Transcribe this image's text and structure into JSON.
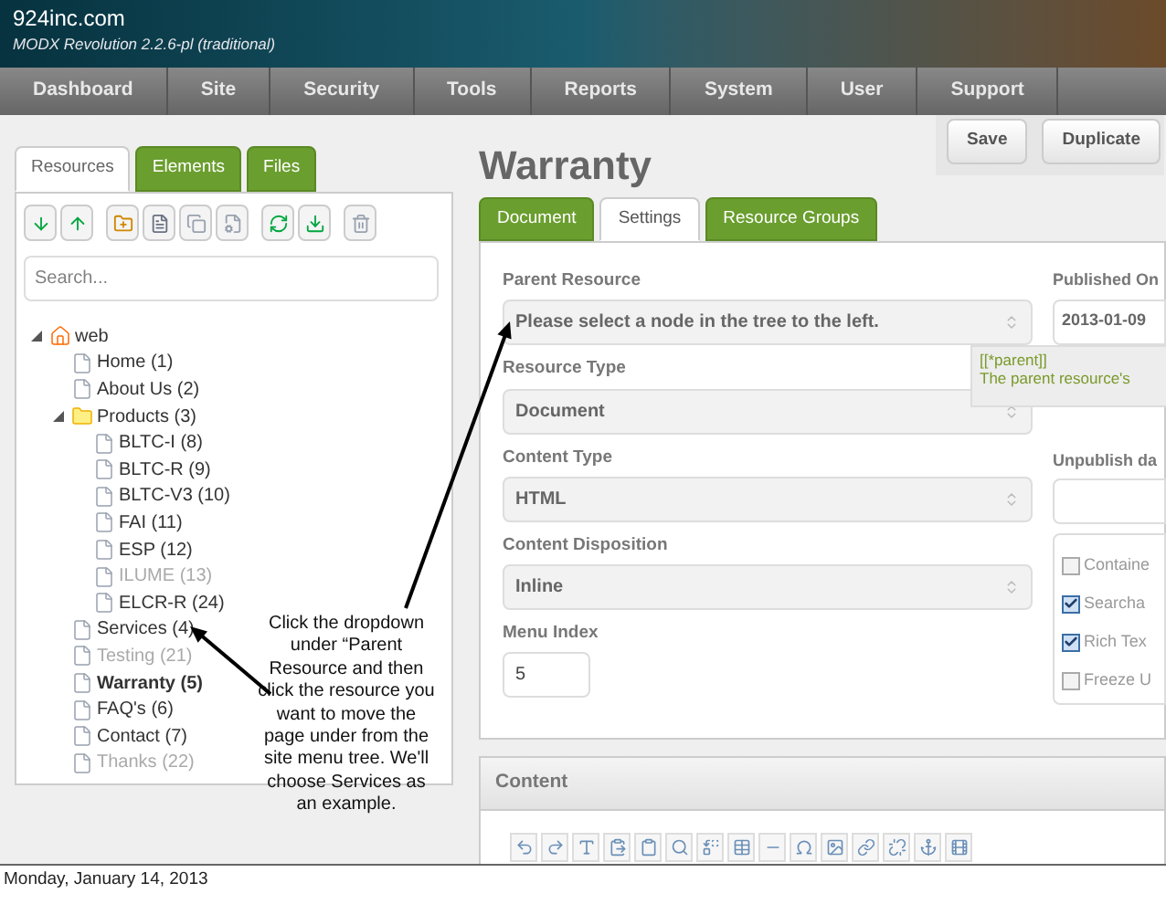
{
  "header": {
    "site": "924inc.com",
    "version": "MODX Revolution 2.2.6-pl (traditional)"
  },
  "nav": [
    "Dashboard",
    "Site",
    "Security",
    "Tools",
    "Reports",
    "System",
    "User",
    "Support"
  ],
  "left_tabs": [
    {
      "label": "Resources",
      "selected": true
    },
    {
      "label": "Elements",
      "selected": false
    },
    {
      "label": "Files",
      "selected": false
    }
  ],
  "search": {
    "placeholder": "Search..."
  },
  "tree": [
    {
      "label": "web",
      "kind": "root",
      "expanded": true,
      "published": true,
      "selected": false,
      "children": [
        {
          "label": "Home (1)",
          "kind": "page",
          "published": true,
          "selected": false
        },
        {
          "label": "About Us (2)",
          "kind": "page",
          "published": true,
          "selected": false
        },
        {
          "label": "Products (3)",
          "kind": "folder",
          "expanded": true,
          "published": true,
          "selected": false,
          "children": [
            {
              "label": "BLTC-I (8)",
              "kind": "page",
              "published": true,
              "selected": false
            },
            {
              "label": "BLTC-R (9)",
              "kind": "page",
              "published": true,
              "selected": false
            },
            {
              "label": "BLTC-V3 (10)",
              "kind": "page",
              "published": true,
              "selected": false
            },
            {
              "label": "FAI (11)",
              "kind": "page",
              "published": true,
              "selected": false
            },
            {
              "label": "ESP (12)",
              "kind": "page",
              "published": true,
              "selected": false
            },
            {
              "label": "ILUME (13)",
              "kind": "page",
              "published": false,
              "selected": false
            },
            {
              "label": "ELCR-R (24)",
              "kind": "page",
              "published": true,
              "selected": false
            }
          ]
        },
        {
          "label": "Services (4)",
          "kind": "page",
          "published": true,
          "selected": false
        },
        {
          "label": "Testing (21)",
          "kind": "page",
          "published": false,
          "selected": false
        },
        {
          "label": "Warranty (5)",
          "kind": "page",
          "published": true,
          "selected": true
        },
        {
          "label": "FAQ's (6)",
          "kind": "page",
          "published": true,
          "selected": false
        },
        {
          "label": "Contact (7)",
          "kind": "page",
          "published": true,
          "selected": false
        },
        {
          "label": "Thanks (22)",
          "kind": "page",
          "published": false,
          "selected": false
        }
      ]
    }
  ],
  "title": "Warranty",
  "buttons": [
    "Save",
    "Duplicate"
  ],
  "tabs": [
    {
      "label": "Document",
      "selected": false
    },
    {
      "label": "Settings",
      "selected": true
    },
    {
      "label": "Resource Groups",
      "selected": false
    }
  ],
  "fields": [
    {
      "label": "Parent Resource",
      "kind": "select",
      "value": "Please select a node in the tree to the left."
    },
    {
      "label": "Resource Type",
      "kind": "select",
      "value": "Document"
    },
    {
      "label": "Content Type",
      "kind": "select",
      "value": "HTML"
    },
    {
      "label": "Content Disposition",
      "kind": "select",
      "value": "Inline"
    },
    {
      "label": "Menu Index",
      "kind": "text",
      "value": "5"
    }
  ],
  "right_fields": [
    {
      "label": "Published On",
      "value": "2013-01-09"
    },
    {
      "label": "Unpublish da"
    }
  ],
  "tooltip": {
    "tag": "[[*parent]]",
    "text": "The parent resource's"
  },
  "checkboxes": [
    {
      "label": "Containe",
      "checked": false
    },
    {
      "label": "Searcha",
      "checked": true
    },
    {
      "label": "Rich Tex",
      "checked": true
    },
    {
      "label": "Freeze U",
      "checked": false
    }
  ],
  "content_section": {
    "title": "Content"
  },
  "callout": "Click the dropdown under “Parent Resource and then click the resource you want to move the page under from the site menu tree. We'll choose Services as an example.",
  "slide_date": "Monday, January 14, 2013"
}
